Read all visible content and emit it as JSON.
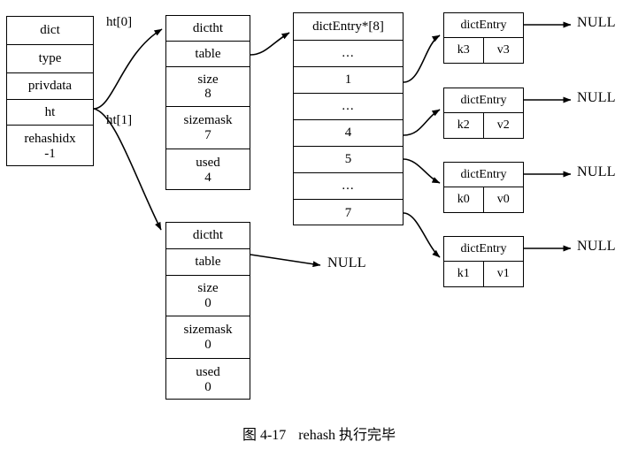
{
  "caption": {
    "figure_number": "图 4-17",
    "text": "rehash 执行完毕"
  },
  "dict_struct": {
    "title": "dict",
    "fields": [
      {
        "name": "type",
        "value": ""
      },
      {
        "name": "privdata",
        "value": ""
      },
      {
        "name": "ht",
        "value": ""
      },
      {
        "name": "rehashidx",
        "value": "-1"
      }
    ]
  },
  "pointer_labels": {
    "ht0": "ht[0]",
    "ht1": "ht[1]"
  },
  "dictht0": {
    "title": "dictht",
    "fields": [
      {
        "name": "table",
        "value": ""
      },
      {
        "name": "size",
        "value": "8"
      },
      {
        "name": "sizemask",
        "value": "7"
      },
      {
        "name": "used",
        "value": "4"
      }
    ]
  },
  "dictht1": {
    "title": "dictht",
    "fields": [
      {
        "name": "table",
        "value": ""
      },
      {
        "name": "size",
        "value": "0"
      },
      {
        "name": "sizemask",
        "value": "0"
      },
      {
        "name": "used",
        "value": "0"
      }
    ]
  },
  "table_array": {
    "title": "dictEntry*[8]",
    "slots": [
      {
        "label": "..."
      },
      {
        "label": "1"
      },
      {
        "label": "..."
      },
      {
        "label": "4"
      },
      {
        "label": "5"
      },
      {
        "label": "..."
      },
      {
        "label": "7"
      }
    ]
  },
  "dict_entries": [
    {
      "title": "dictEntry",
      "key": "k3",
      "value": "v3",
      "next": "NULL"
    },
    {
      "title": "dictEntry",
      "key": "k2",
      "value": "v2",
      "next": "NULL"
    },
    {
      "title": "dictEntry",
      "key": "k0",
      "value": "v0",
      "next": "NULL"
    },
    {
      "title": "dictEntry",
      "key": "k1",
      "value": "v1",
      "next": "NULL"
    }
  ],
  "null_labels": {
    "entry0": "NULL",
    "entry1": "NULL",
    "entry2": "NULL",
    "entry3": "NULL",
    "dictht1_table": "NULL"
  },
  "colors": {
    "line": "#000000",
    "background": "#ffffff",
    "text": "#000000"
  }
}
